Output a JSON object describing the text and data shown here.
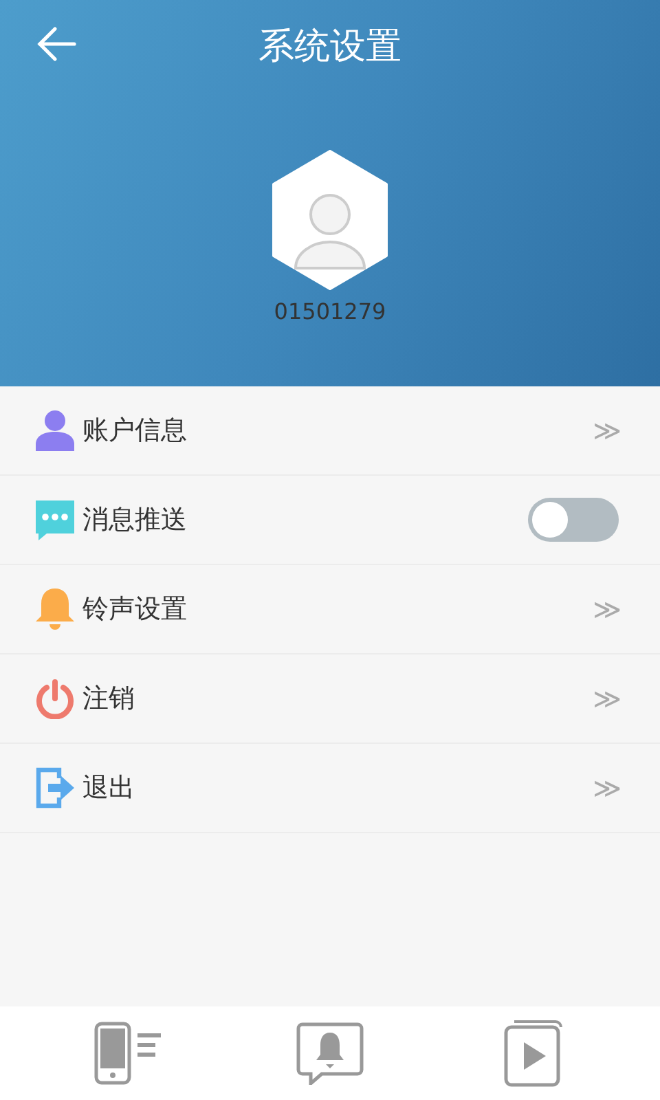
{
  "header": {
    "title": "系统设置",
    "account": "01501279"
  },
  "items": [
    {
      "label": "账户信息",
      "kind": "link"
    },
    {
      "label": "消息推送",
      "kind": "toggle",
      "on": false
    },
    {
      "label": "铃声设置",
      "kind": "link"
    },
    {
      "label": "注销",
      "kind": "link"
    },
    {
      "label": "退出",
      "kind": "link"
    }
  ],
  "chevron": "≫"
}
